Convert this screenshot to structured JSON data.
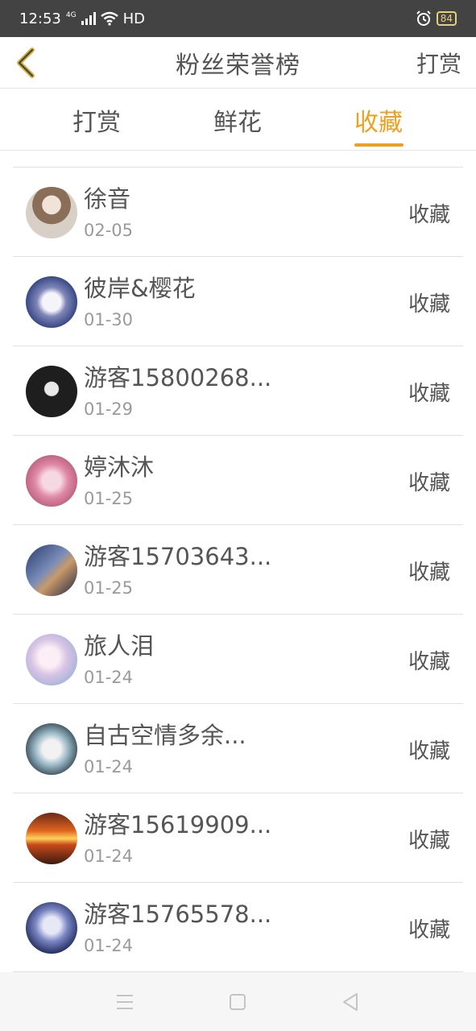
{
  "status_bar": {
    "time": "12:53",
    "network": "4G",
    "hd": "HD",
    "battery": "84"
  },
  "header": {
    "title": "粉丝荣誉榜",
    "right_action": "打赏"
  },
  "tabs": [
    {
      "label": "打赏",
      "active": false
    },
    {
      "label": "鲜花",
      "active": false
    },
    {
      "label": "收藏",
      "active": true
    }
  ],
  "colors": {
    "accent": "#f0a020",
    "status_bar_bg": "#434343"
  },
  "list": [
    {
      "name": "徐音",
      "date": "02-05",
      "action": "收藏"
    },
    {
      "name": "彼岸&樱花",
      "date": "01-30",
      "action": "收藏"
    },
    {
      "name": "游客15800268...",
      "date": "01-29",
      "action": "收藏"
    },
    {
      "name": "婷沐沐",
      "date": "01-25",
      "action": "收藏"
    },
    {
      "name": "游客15703643...",
      "date": "01-25",
      "action": "收藏"
    },
    {
      "name": "旅人泪",
      "date": "01-24",
      "action": "收藏"
    },
    {
      "name": "自古空情多余...",
      "date": "01-24",
      "action": "收藏"
    },
    {
      "name": "游客15619909...",
      "date": "01-24",
      "action": "收藏"
    },
    {
      "name": "游客15765578...",
      "date": "01-24",
      "action": "收藏"
    }
  ],
  "icons": {
    "back": "chevron-left-icon",
    "menu": "menu-icon",
    "home": "home-icon",
    "back_nav": "triangle-back-icon"
  }
}
